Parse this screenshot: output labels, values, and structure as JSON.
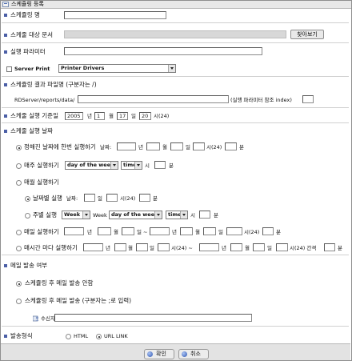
{
  "window": {
    "title": "스케쥴링 등록"
  },
  "schedule_name": {
    "label": "스케쥴링 명",
    "value": ""
  },
  "target_doc": {
    "label": "스케줄 대상 문서",
    "value": "",
    "browse_label": "찾아보기"
  },
  "exec_params": {
    "label": "실행 파라미터",
    "value": ""
  },
  "server_print": {
    "label": "Server Print",
    "checked": false,
    "select_value": "Printer Drivers"
  },
  "result_file": {
    "label": "스케쥴링 결과 파일명 (구분자는 /)",
    "prefix": "RDServer/reports/data/",
    "value": "",
    "hint": "(실행 파라미터 참조 index)",
    "index_value": ""
  },
  "base_date": {
    "label": "스케줄 실행 기준일",
    "year": "2005",
    "year_unit": "년",
    "month": "1",
    "month_unit": "월",
    "day": "17",
    "day_unit": "일",
    "hour": "20",
    "hour_unit": "시(24)"
  },
  "exec_date": {
    "label": "스케줄 실행 날짜"
  },
  "once": {
    "label": "정해진 날짜에 한번 실행하기",
    "date_label": "날짜:",
    "u_year": "년",
    "u_month": "월",
    "u_day": "일",
    "u_hour": "시(24)",
    "u_min": "분"
  },
  "weekly": {
    "label": "매주 실행하기",
    "dow": "day of the week",
    "time": "time",
    "u_hour": "시",
    "u_min": "분"
  },
  "monthly": {
    "label": "매월 실행하기"
  },
  "by_date": {
    "label": "날짜별 실행",
    "date_label": "날짜:",
    "u_day": "일",
    "u_hour": "시(24)",
    "u_min": "분"
  },
  "by_week": {
    "label": "주별 실행",
    "week_sel": "Week",
    "week_word": "Week",
    "dow": "day of the week",
    "time": "time",
    "u_hour": "시",
    "u_min": "분"
  },
  "daily": {
    "label": "매일 실행하기",
    "u_year": "년",
    "u_month": "월",
    "u_day": "일 ~",
    "u_year2": "년",
    "u_month2": "월",
    "u_day2": "일",
    "u_hour": "시(24)",
    "u_min": "분"
  },
  "interval": {
    "label": "매시간 마다 실행하기",
    "u_year": "년",
    "u_month": "월",
    "u_day": "일",
    "u_hour": "시(24) ~",
    "u_year2": "년",
    "u_month2": "월",
    "u_day2": "일",
    "u_interval": "시(24) 간격",
    "u_min": "분"
  },
  "mail": {
    "label": "메일 발송 여부",
    "no_mail": "스케쥴링 후 메일 발송 안함",
    "send_mail": "스케쥴링 후 메일 발송 (구분자는 ;로 입력)",
    "recipient_label": "수신자",
    "recipient_value": ""
  },
  "send_format": {
    "label": "발송형식",
    "html": "HTML",
    "url": "URL LINK"
  },
  "footer": {
    "ok_label": "확인",
    "cancel_label": "취소"
  },
  "colors": {
    "section_square": "#4b5fa6",
    "button_icon": "#2f56b0"
  }
}
